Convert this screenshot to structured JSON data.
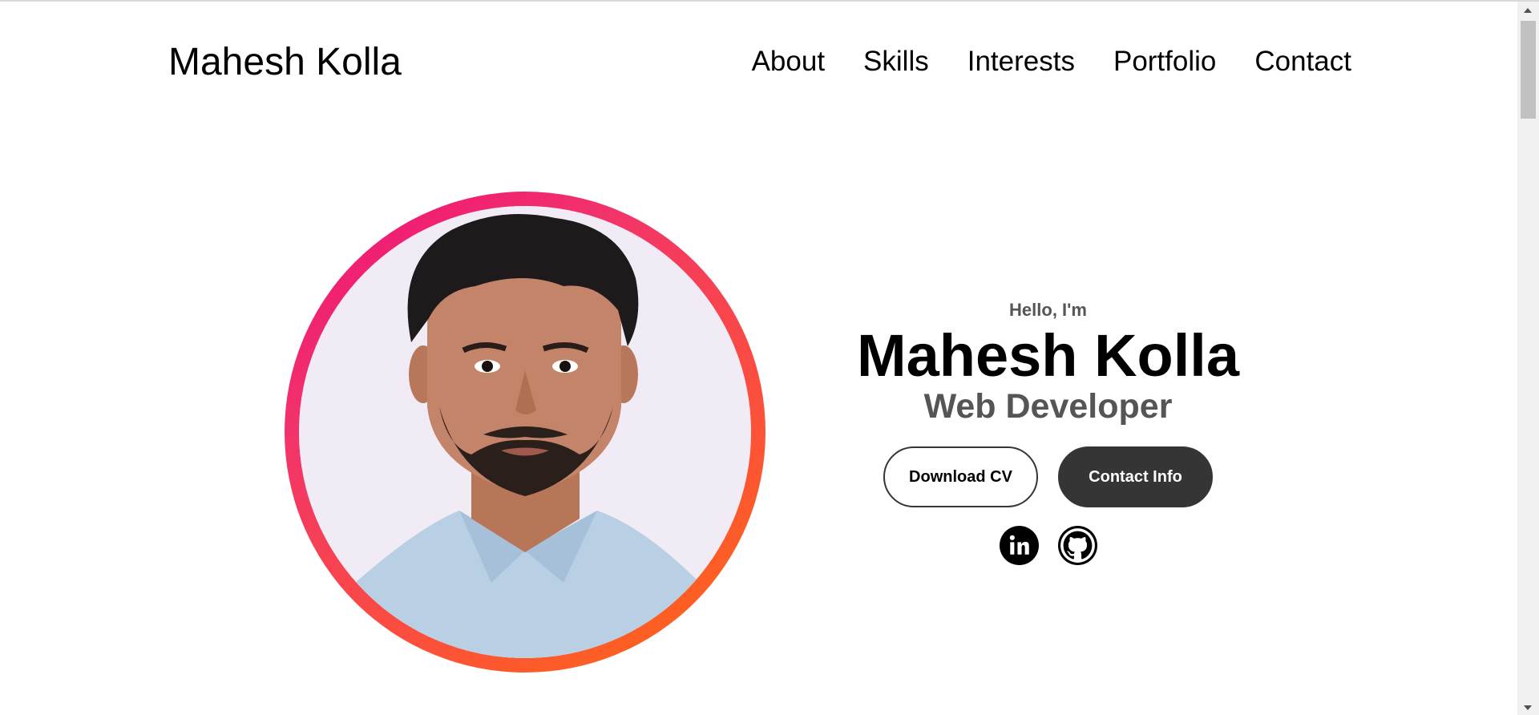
{
  "nav": {
    "logo": "Mahesh Kolla",
    "links": [
      "About",
      "Skills",
      "Interests",
      "Portfolio",
      "Contact"
    ]
  },
  "hero": {
    "greeting": "Hello, I'm",
    "name": "Mahesh Kolla",
    "title": "Web Developer",
    "download_cv_label": "Download CV",
    "contact_info_label": "Contact Info",
    "socials": [
      {
        "icon": "linkedin-icon"
      },
      {
        "icon": "github-icon"
      }
    ],
    "profile_picture": {
      "icon": "profile-photo"
    }
  },
  "colors": {
    "ring_start": "#ee0d78",
    "ring_end": "#ff6a10",
    "button_dark": "#353535",
    "subtext": "#555555"
  }
}
